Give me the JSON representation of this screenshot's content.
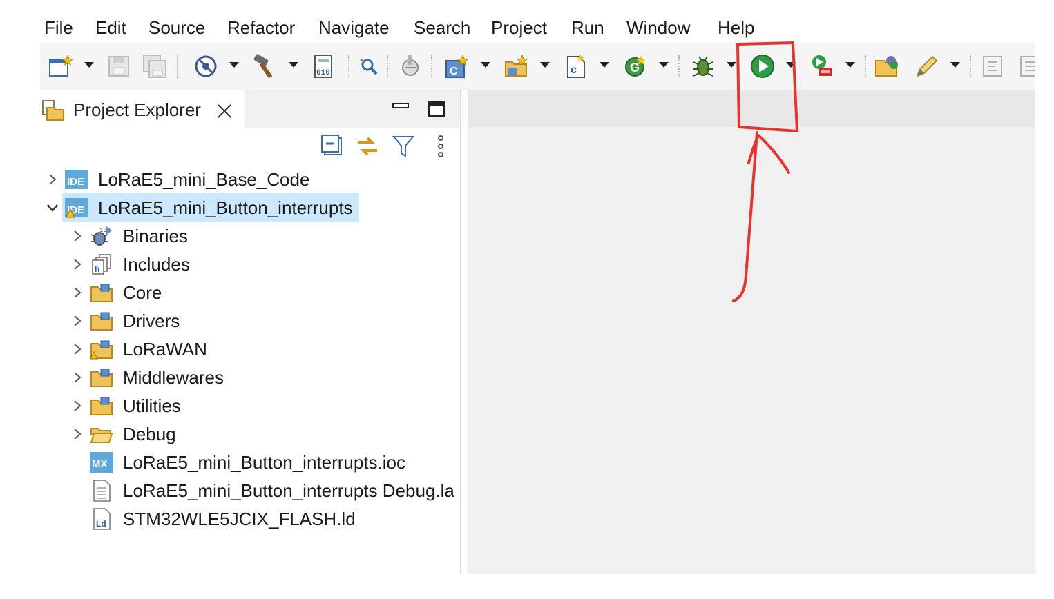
{
  "menu": {
    "items": [
      "File",
      "Edit",
      "Source",
      "Refactor",
      "Navigate",
      "Search",
      "Project",
      "Run",
      "Window",
      "Help"
    ]
  },
  "toolbar": {
    "icons": [
      "new-icon",
      "save-icon",
      "save-all-icon",
      "build-config-icon",
      "hammer-build-icon",
      "binary-icon",
      "search-icon",
      "debug-config-icon",
      "new-c-project-icon",
      "new-source-folder-icon",
      "new-c-class-icon",
      "refresh-icon",
      "debug-bug-icon",
      "run-play-icon",
      "run-external-icon",
      "open-folder-icon",
      "pen-icon",
      "toggle-icon"
    ]
  },
  "explorer": {
    "tab_label": "Project Explorer",
    "items": [
      {
        "label": "LoRaE5_mini_Base_Code",
        "icon": "ide-project-icon"
      },
      {
        "label": "LoRaE5_mini_Button_interrupts",
        "icon": "ide-project-icon"
      },
      {
        "label": "Binaries",
        "icon": "binaries-icon"
      },
      {
        "label": "Includes",
        "icon": "includes-icon"
      },
      {
        "label": "Core",
        "icon": "source-folder-icon"
      },
      {
        "label": "Drivers",
        "icon": "source-folder-icon"
      },
      {
        "label": "LoRaWAN",
        "icon": "source-folder-icon"
      },
      {
        "label": "Middlewares",
        "icon": "source-folder-icon"
      },
      {
        "label": "Utilities",
        "icon": "source-folder-icon"
      },
      {
        "label": "Debug",
        "icon": "folder-icon"
      },
      {
        "label": "LoRaE5_mini_Button_interrupts.ioc",
        "icon": "mx-file-icon",
        "badge": "MX"
      },
      {
        "label": "LoRaE5_mini_Button_interrupts Debug.la",
        "icon": "text-file-icon"
      },
      {
        "label": "STM32WLE5JCIX_FLASH.ld",
        "icon": "linker-file-icon",
        "badge": "Ld"
      }
    ]
  },
  "badges": {
    "ide": "IDE"
  },
  "colors": {
    "accent_red": "#e8322c",
    "selection": "#cce8ff",
    "run_green": "#2e9e44"
  }
}
